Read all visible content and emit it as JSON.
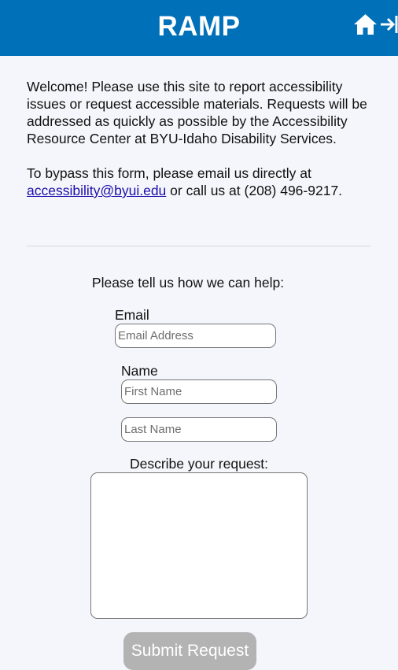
{
  "header": {
    "title": "RAMP",
    "background_color": "#0070b8",
    "icons": [
      "home-icon",
      "exit-icon"
    ]
  },
  "intro": {
    "paragraph1": "Welcome! Please use this site to report accessibility issues or request accessible materials. Requests will be addressed as quickly as possible by the Accessibility Resource Center at BYU-Idaho Disability Services.",
    "paragraph2_prefix": "To bypass this form, please email us directly at ",
    "email_link": "accessibility@byui.edu",
    "paragraph2_suffix": " or call us at (208) 496-9217."
  },
  "form": {
    "prompt": "Please tell us how we can help:",
    "email_label": "Email",
    "email_placeholder": "Email Address",
    "name_label": "Name",
    "first_name_placeholder": "First Name",
    "last_name_placeholder": "Last Name",
    "description_label": "Describe your request:",
    "description_value": "",
    "submit_label": "Submit Request",
    "submit_color": "#b3b3b3"
  }
}
